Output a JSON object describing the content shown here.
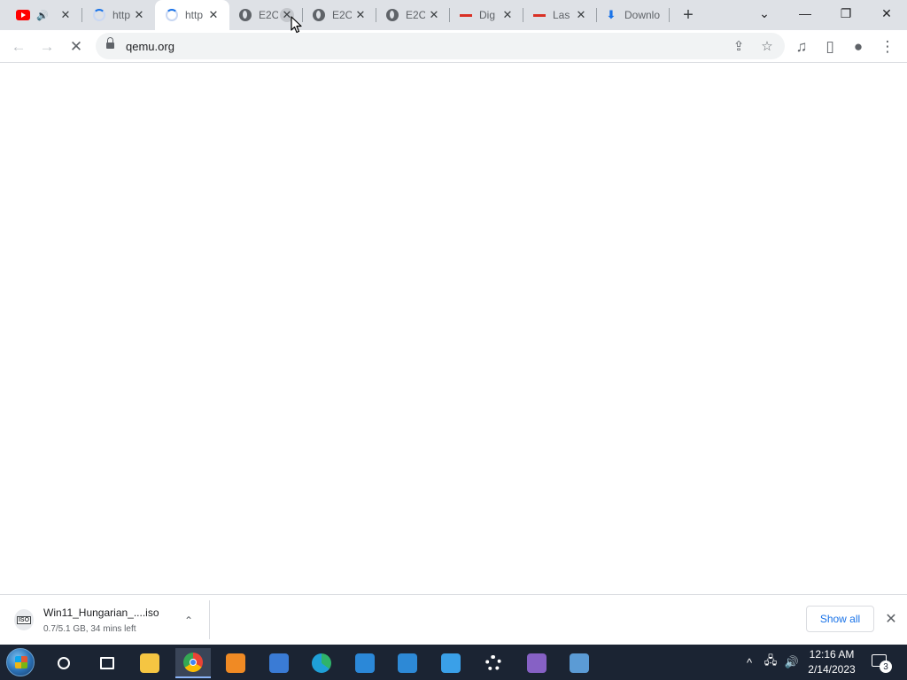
{
  "tabs": [
    {
      "title": "",
      "favicon": "youtube-icon",
      "audio": "🔊",
      "active": false
    },
    {
      "title": "http",
      "favicon": "loading-spinner-icon",
      "active": false
    },
    {
      "title": "http",
      "favicon": "loading-spinner-icon",
      "active": true
    },
    {
      "title": "E2C",
      "favicon": "globe-icon",
      "active": false
    },
    {
      "title": "E2C",
      "favicon": "globe-icon",
      "active": false
    },
    {
      "title": "E2C",
      "favicon": "globe-icon",
      "active": false
    },
    {
      "title": "Dig",
      "favicon": "red-dash-icon",
      "active": false
    },
    {
      "title": "Las",
      "favicon": "red-dash-icon",
      "active": false
    },
    {
      "title": "Downlo",
      "favicon": "download-icon",
      "active": false
    }
  ],
  "glyphs": {
    "close": "✕",
    "new_tab": "+",
    "tab_search": "⌄",
    "minimize": "—",
    "restore": "❐",
    "window_close": "✕",
    "back": "←",
    "forward": "→",
    "stop_loading": "✕",
    "share": "⇪",
    "bookmark": "☆",
    "media": "♫",
    "side_panel": "▯",
    "profile": "●",
    "menu": "⋮",
    "chevron_up": "⌃",
    "tray_up": "^",
    "network": "🖧",
    "volume": "🔊"
  },
  "address_bar": {
    "url": "qemu.org"
  },
  "download_shelf": {
    "file_name": "Win11_Hungarian_....iso",
    "file_badge": "ISO",
    "status": "0.7/5.1 GB, 34 mins left",
    "show_all_label": "Show all"
  },
  "taskbar": {
    "pinned": [
      {
        "name": "search-icon",
        "color": "#ffffff"
      },
      {
        "name": "task-view-icon",
        "color": "#ffffff"
      },
      {
        "name": "file-explorer-icon",
        "color": "#f5c542"
      },
      {
        "name": "chrome-icon",
        "color": "#34a853",
        "active": true
      },
      {
        "name": "magnifier-app-icon",
        "color": "#f08a24"
      },
      {
        "name": "calculator-icon",
        "color": "#3a7bd5"
      },
      {
        "name": "edge-icon",
        "color": "#1fa0d8"
      },
      {
        "name": "store-icon",
        "color": "#2b88d8"
      },
      {
        "name": "photos-icon",
        "color": "#2d89d6"
      },
      {
        "name": "people-icon",
        "color": "#3aa0e8"
      },
      {
        "name": "settings-gear-icon",
        "color": "#ffffff"
      },
      {
        "name": "visual-studio-icon",
        "color": "#8661c5"
      },
      {
        "name": "remote-desktop-icon",
        "color": "#5b9bd5"
      }
    ],
    "clock_time": "12:16 AM",
    "clock_date": "2/14/2023",
    "notification_count": "3"
  },
  "colors": {
    "accent": "#1a73e8",
    "tabstrip": "#dee1e6",
    "taskbar": "#1b2433"
  }
}
